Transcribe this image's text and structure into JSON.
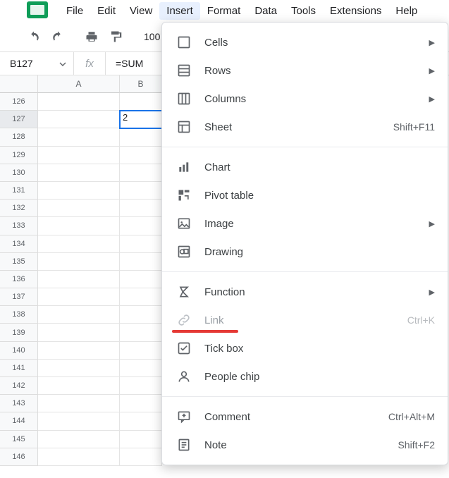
{
  "menubar": {
    "items": [
      "File",
      "Edit",
      "View",
      "Insert",
      "Format",
      "Data",
      "Tools",
      "Extensions",
      "Help"
    ],
    "active_index": 3
  },
  "toolbar": {
    "zoom": "100"
  },
  "namebox": {
    "value": "B127"
  },
  "formula_bar": {
    "fx_label": "fx",
    "value": "=SUM"
  },
  "columns": [
    "A",
    "B"
  ],
  "rows": {
    "start": 126,
    "count": 21,
    "selected_row": 127,
    "selected_col": "B",
    "selected_cell_value": "2"
  },
  "insert_menu": {
    "groups": [
      [
        {
          "icon": "cells-icon",
          "label": "Cells",
          "submenu": true
        },
        {
          "icon": "rows-icon",
          "label": "Rows",
          "submenu": true
        },
        {
          "icon": "columns-icon",
          "label": "Columns",
          "submenu": true
        },
        {
          "icon": "sheet-icon",
          "label": "Sheet",
          "shortcut": "Shift+F11"
        }
      ],
      [
        {
          "icon": "chart-icon",
          "label": "Chart"
        },
        {
          "icon": "pivot-icon",
          "label": "Pivot table"
        },
        {
          "icon": "image-icon",
          "label": "Image",
          "submenu": true
        },
        {
          "icon": "drawing-icon",
          "label": "Drawing"
        }
      ],
      [
        {
          "icon": "function-icon",
          "label": "Function",
          "submenu": true
        },
        {
          "icon": "link-icon",
          "label": "Link",
          "shortcut": "Ctrl+K",
          "disabled": true,
          "annotated": true
        },
        {
          "icon": "tickbox-icon",
          "label": "Tick box"
        },
        {
          "icon": "people-icon",
          "label": "People chip"
        }
      ],
      [
        {
          "icon": "comment-icon",
          "label": "Comment",
          "shortcut": "Ctrl+Alt+M"
        },
        {
          "icon": "note-icon",
          "label": "Note",
          "shortcut": "Shift+F2"
        }
      ]
    ]
  }
}
